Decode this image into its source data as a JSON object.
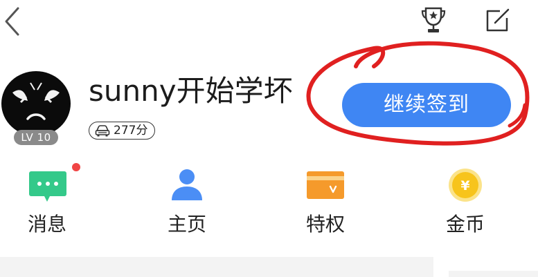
{
  "topbar": {
    "back_icon": "chevron-left-icon",
    "trophy_icon": "trophy-icon",
    "edit_icon": "edit-icon"
  },
  "profile": {
    "avatar_icon": "angry-face-avatar",
    "level": "LV 10",
    "username": "sunny开始学坏",
    "points": "277分",
    "points_icon": "car-icon"
  },
  "checkin": {
    "label": "继续签到",
    "color": "#3f86f3"
  },
  "actions": [
    {
      "label": "消息",
      "icon": "message-icon",
      "color": "#34c98a",
      "has_dot": true
    },
    {
      "label": "主页",
      "icon": "user-icon",
      "color": "#4b8ef5",
      "has_dot": false
    },
    {
      "label": "特权",
      "icon": "vip-card-icon",
      "color": "#f59a2b",
      "has_dot": false
    },
    {
      "label": "金币",
      "icon": "coin-icon",
      "color": "#f7c41c",
      "has_dot": false
    }
  ],
  "annotation": {
    "color": "#e02020"
  }
}
